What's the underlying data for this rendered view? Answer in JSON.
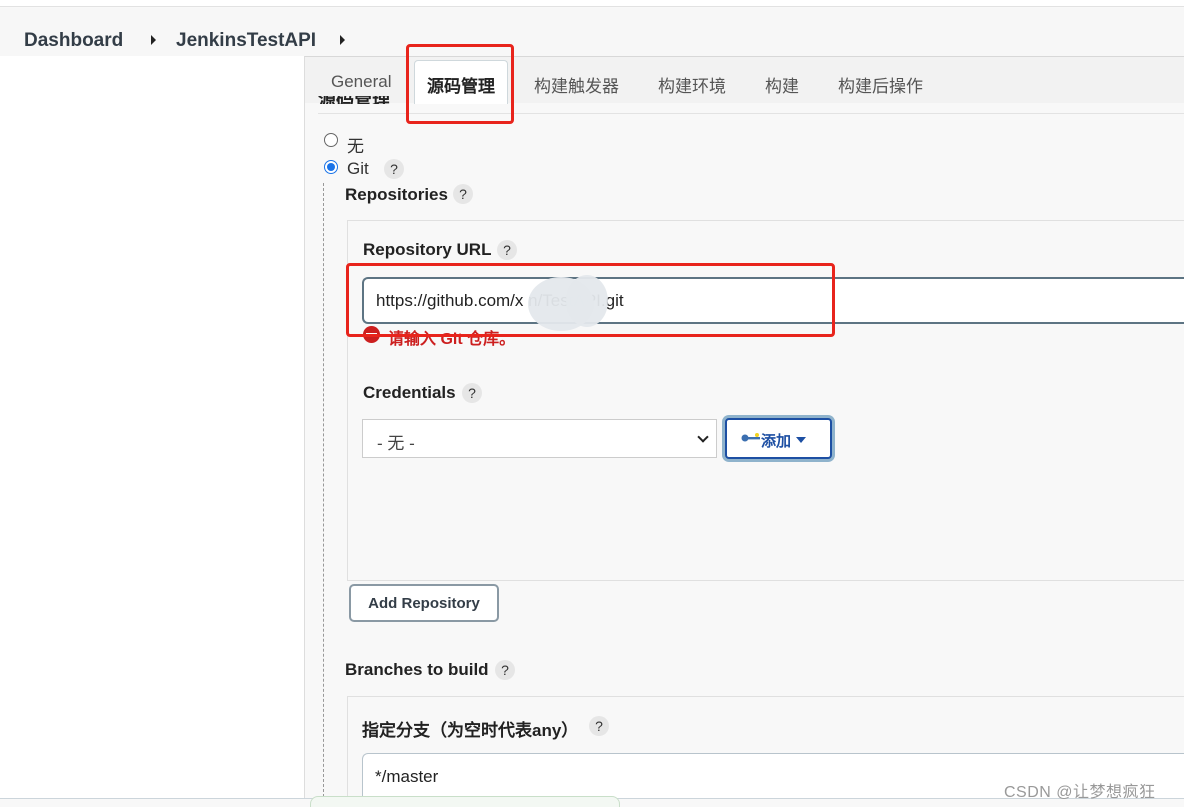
{
  "breadcrumb": {
    "items": [
      "Dashboard",
      "JenkinsTestAPI"
    ]
  },
  "tabs": [
    {
      "label": "General",
      "active": false
    },
    {
      "label": "源码管理",
      "active": true
    },
    {
      "label": "构建触发器",
      "active": false
    },
    {
      "label": "构建环境",
      "active": false
    },
    {
      "label": "构建",
      "active": false
    },
    {
      "label": "构建后操作",
      "active": false
    }
  ],
  "section": {
    "title": "源码管理"
  },
  "scm": {
    "options": [
      {
        "label": "无",
        "checked": false
      },
      {
        "label": "Git",
        "checked": true
      }
    ],
    "help_glyph": "?"
  },
  "repositories": {
    "label": "Repositories",
    "url_label": "Repository URL",
    "url_value": "https://github.com/x          n/TestAPI.git",
    "error_text": "请输入 Git 仓库。",
    "credentials_label": "Credentials",
    "credentials_selected": "- 无 -",
    "add_button_label": "添加",
    "add_repository_label": "Add Repository"
  },
  "branches": {
    "label": "Branches to build",
    "spec_label": "指定分支（为空时代表any）",
    "spec_value": "*/master"
  },
  "watermark": "CSDN @让梦想疯狂",
  "colors": {
    "error": "#cc1f1f",
    "highlight_box": "#e8241c",
    "primary": "#1d4fa3",
    "radio_checked": "#1a73e8"
  }
}
